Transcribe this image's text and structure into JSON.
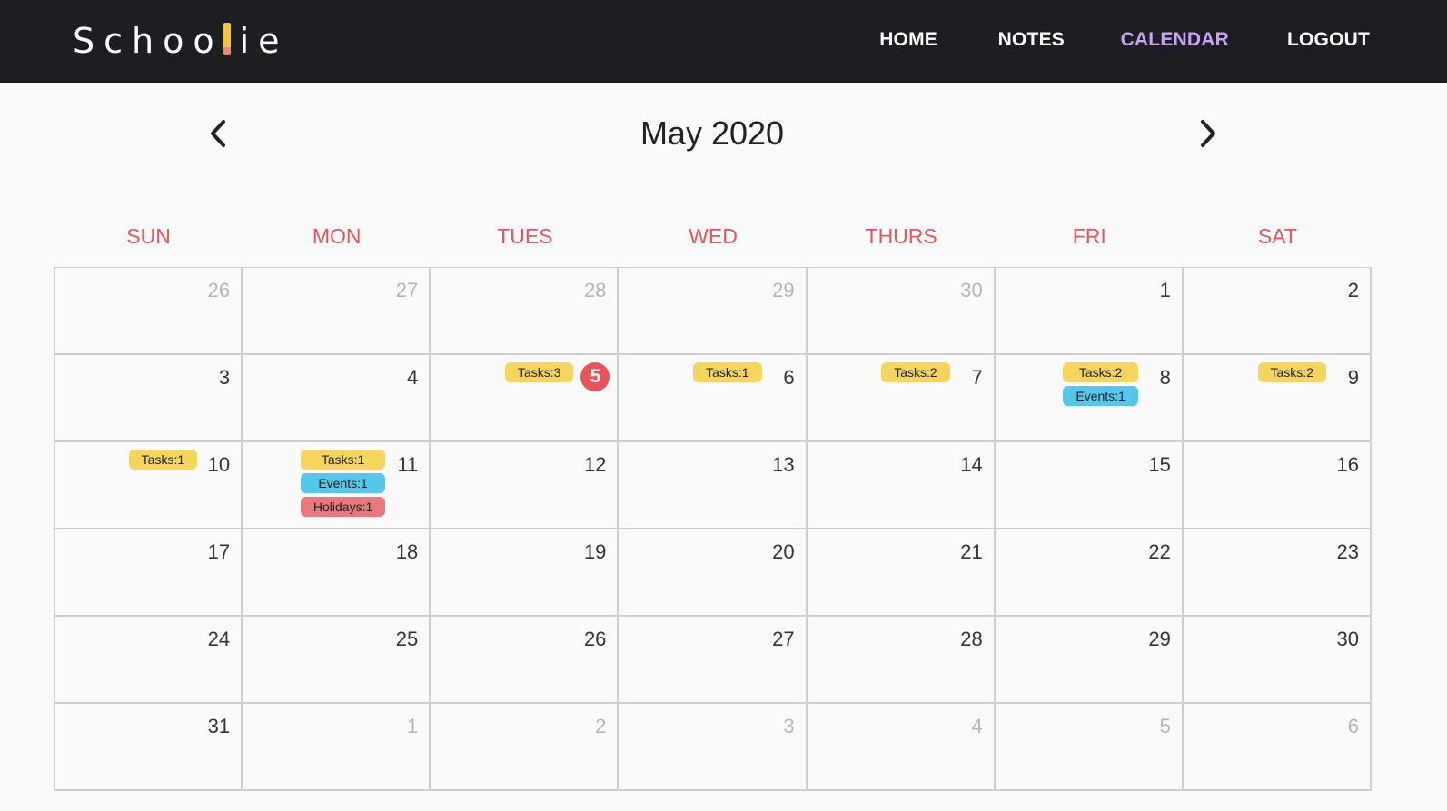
{
  "brand": {
    "before": "Schoo",
    "after": "ie"
  },
  "nav": {
    "home": "HOME",
    "notes": "NOTES",
    "calendar": "CALENDAR",
    "logout": "LOGOUT",
    "active": "calendar"
  },
  "calendar": {
    "title": "May 2020",
    "weekdays": [
      "SUN",
      "MON",
      "TUES",
      "WED",
      "THURS",
      "FRI",
      "SAT"
    ],
    "today": "5",
    "colors": {
      "weekday": "#e9545a",
      "today": "#e9545a",
      "tasks": "#f6d55c",
      "events": "#54c7ec",
      "holidays": "#e9797c"
    },
    "weeks": [
      [
        {
          "day": "26",
          "other": true,
          "badges": []
        },
        {
          "day": "27",
          "other": true,
          "badges": []
        },
        {
          "day": "28",
          "other": true,
          "badges": []
        },
        {
          "day": "29",
          "other": true,
          "badges": []
        },
        {
          "day": "30",
          "other": true,
          "badges": []
        },
        {
          "day": "1",
          "other": false,
          "badges": []
        },
        {
          "day": "2",
          "other": false,
          "badges": []
        }
      ],
      [
        {
          "day": "3",
          "other": false,
          "badges": []
        },
        {
          "day": "4",
          "other": false,
          "badges": []
        },
        {
          "day": "5",
          "other": false,
          "badges": [
            {
              "type": "tasks",
              "label": "Tasks:3"
            }
          ]
        },
        {
          "day": "6",
          "other": false,
          "badges": [
            {
              "type": "tasks",
              "label": "Tasks:1"
            }
          ]
        },
        {
          "day": "7",
          "other": false,
          "badges": [
            {
              "type": "tasks",
              "label": "Tasks:2"
            }
          ]
        },
        {
          "day": "8",
          "other": false,
          "badges": [
            {
              "type": "tasks",
              "label": "Tasks:2"
            },
            {
              "type": "events",
              "label": "Events:1"
            }
          ]
        },
        {
          "day": "9",
          "other": false,
          "badges": [
            {
              "type": "tasks",
              "label": "Tasks:2"
            }
          ]
        }
      ],
      [
        {
          "day": "10",
          "other": false,
          "badges": [
            {
              "type": "tasks",
              "label": "Tasks:1"
            }
          ]
        },
        {
          "day": "11",
          "other": false,
          "badges": [
            {
              "type": "tasks",
              "label": "Tasks:1"
            },
            {
              "type": "events",
              "label": "Events:1"
            },
            {
              "type": "holidays",
              "label": "Holidays:1"
            }
          ]
        },
        {
          "day": "12",
          "other": false,
          "badges": []
        },
        {
          "day": "13",
          "other": false,
          "badges": []
        },
        {
          "day": "14",
          "other": false,
          "badges": []
        },
        {
          "day": "15",
          "other": false,
          "badges": []
        },
        {
          "day": "16",
          "other": false,
          "badges": []
        }
      ],
      [
        {
          "day": "17",
          "other": false,
          "badges": []
        },
        {
          "day": "18",
          "other": false,
          "badges": []
        },
        {
          "day": "19",
          "other": false,
          "badges": []
        },
        {
          "day": "20",
          "other": false,
          "badges": []
        },
        {
          "day": "21",
          "other": false,
          "badges": []
        },
        {
          "day": "22",
          "other": false,
          "badges": []
        },
        {
          "day": "23",
          "other": false,
          "badges": []
        }
      ],
      [
        {
          "day": "24",
          "other": false,
          "badges": []
        },
        {
          "day": "25",
          "other": false,
          "badges": []
        },
        {
          "day": "26",
          "other": false,
          "badges": []
        },
        {
          "day": "27",
          "other": false,
          "badges": []
        },
        {
          "day": "28",
          "other": false,
          "badges": []
        },
        {
          "day": "29",
          "other": false,
          "badges": []
        },
        {
          "day": "30",
          "other": false,
          "badges": []
        }
      ],
      [
        {
          "day": "31",
          "other": false,
          "badges": []
        },
        {
          "day": "1",
          "other": true,
          "badges": []
        },
        {
          "day": "2",
          "other": true,
          "badges": []
        },
        {
          "day": "3",
          "other": true,
          "badges": []
        },
        {
          "day": "4",
          "other": true,
          "badges": []
        },
        {
          "day": "5",
          "other": true,
          "badges": []
        },
        {
          "day": "6",
          "other": true,
          "badges": []
        }
      ]
    ]
  }
}
